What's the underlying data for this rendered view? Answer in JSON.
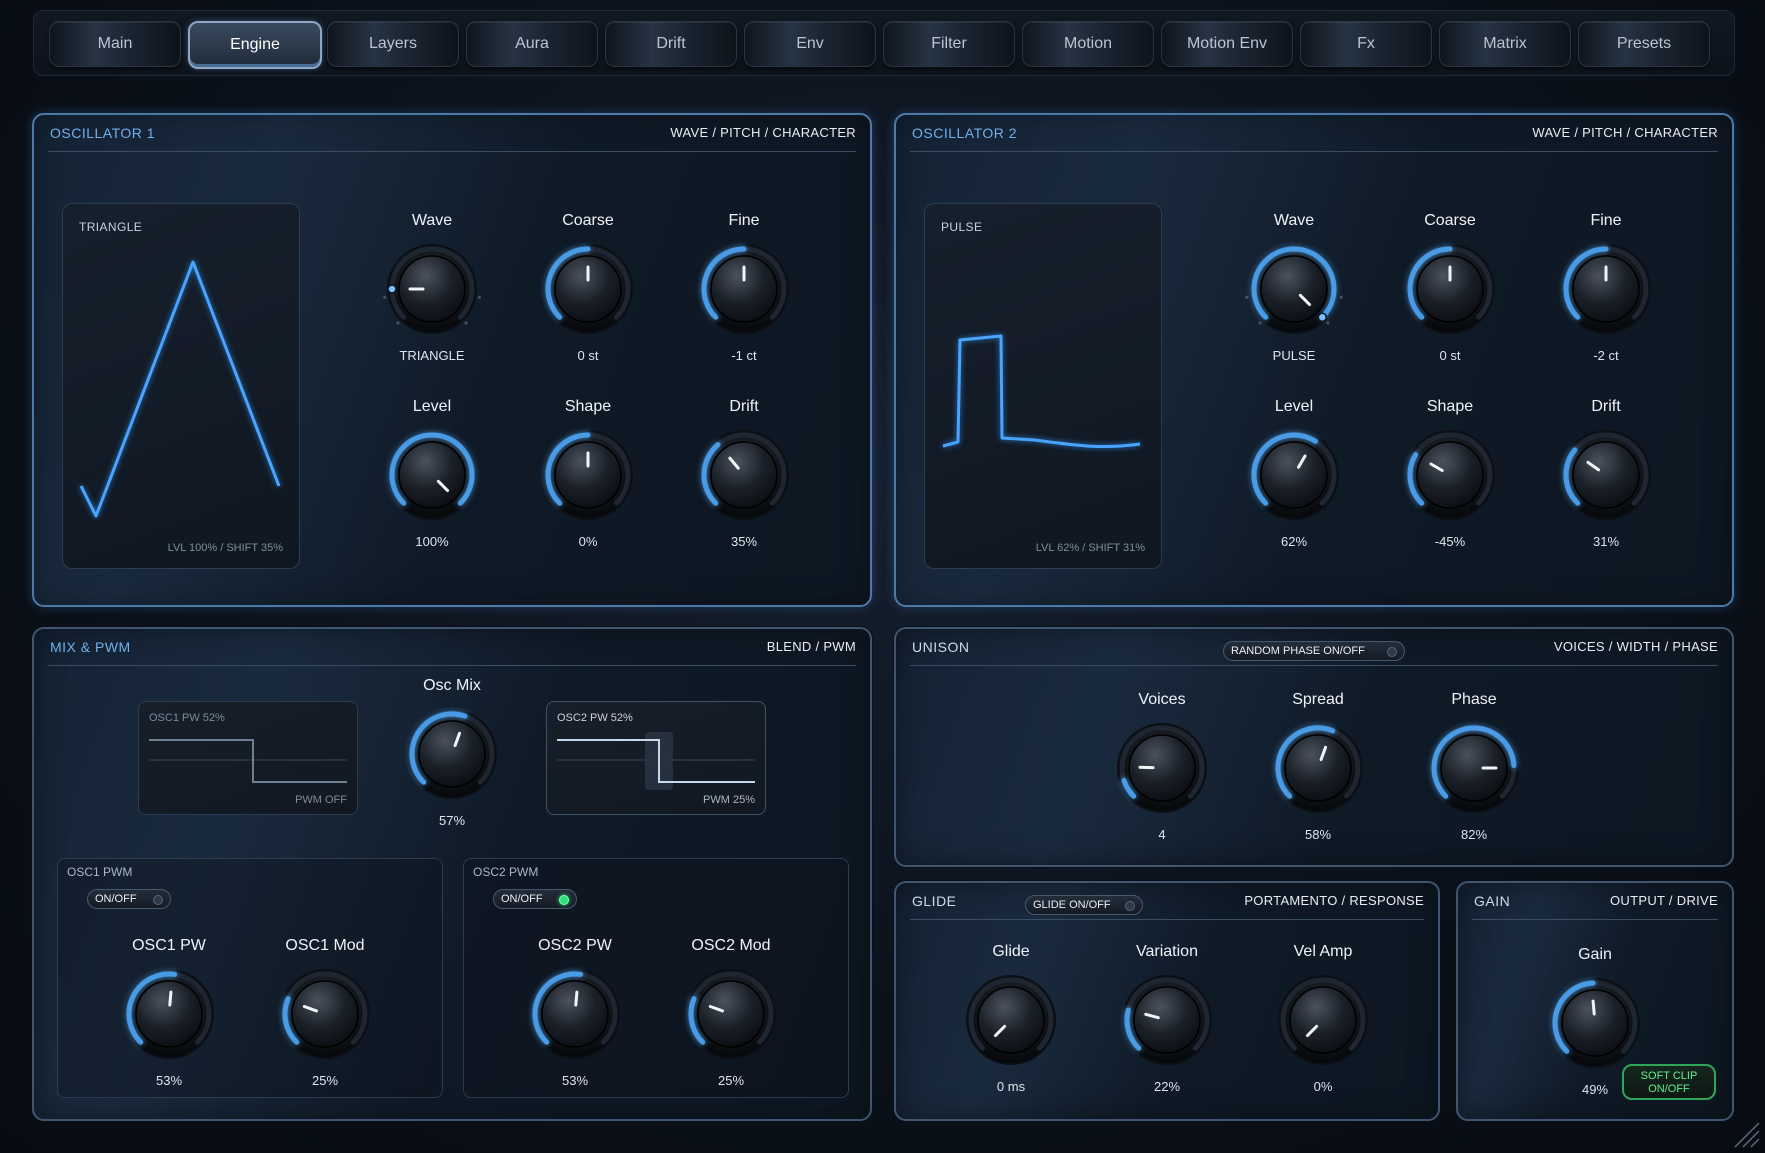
{
  "tabs": [
    {
      "label": "Main",
      "active": false
    },
    {
      "label": "Engine",
      "active": true
    },
    {
      "label": "Layers",
      "active": false
    },
    {
      "label": "Aura",
      "active": false
    },
    {
      "label": "Drift",
      "active": false
    },
    {
      "label": "Env",
      "active": false
    },
    {
      "label": "Filter",
      "active": false
    },
    {
      "label": "Motion",
      "active": false
    },
    {
      "label": "Motion Env",
      "active": false
    },
    {
      "label": "Fx",
      "active": false
    },
    {
      "label": "Matrix",
      "active": false
    },
    {
      "label": "Presets",
      "active": false
    }
  ],
  "osc1": {
    "title": "OSCILLATOR 1",
    "subtitle": "WAVE / PITCH / CHARACTER",
    "display": {
      "name": "TRIANGLE",
      "footer": "LVL 100% / SHIFT 35%"
    },
    "knobs": [
      {
        "label": "Wave",
        "value": "TRIANGLE"
      },
      {
        "label": "Coarse",
        "value": "0 st"
      },
      {
        "label": "Fine",
        "value": "-1 ct"
      },
      {
        "label": "Level",
        "value": "100%"
      },
      {
        "label": "Shape",
        "value": "0%"
      },
      {
        "label": "Drift",
        "value": "35%"
      }
    ]
  },
  "osc2": {
    "title": "OSCILLATOR 2",
    "subtitle": "WAVE / PITCH / CHARACTER",
    "display": {
      "name": "PULSE",
      "footer": "LVL 62% / SHIFT 31%"
    },
    "knobs": [
      {
        "label": "Wave",
        "value": "PULSE"
      },
      {
        "label": "Coarse",
        "value": "0 st"
      },
      {
        "label": "Fine",
        "value": "-2 ct"
      },
      {
        "label": "Level",
        "value": "62%"
      },
      {
        "label": "Shape",
        "value": "-45%"
      },
      {
        "label": "Drift",
        "value": "31%"
      }
    ]
  },
  "mix": {
    "title": "MIX & PWM",
    "subtitle": "BLEND / PWM",
    "osc1_pw_display": {
      "name": "OSC1 PW 52%",
      "footer": "PWM OFF"
    },
    "osc2_pw_display": {
      "name": "OSC2 PW 52%",
      "footer": "PWM 25%"
    },
    "osc_mix": {
      "label": "Osc Mix",
      "value": "57%"
    },
    "osc1_pwm": {
      "title": "OSC1 PWM",
      "toggle": "ON/OFF",
      "toggle_on": false,
      "knobs": [
        {
          "label": "OSC1 PW",
          "value": "53%"
        },
        {
          "label": "OSC1 Mod",
          "value": "25%"
        }
      ]
    },
    "osc2_pwm": {
      "title": "OSC2 PWM",
      "toggle": "ON/OFF",
      "toggle_on": true,
      "knobs": [
        {
          "label": "OSC2 PW",
          "value": "53%"
        },
        {
          "label": "OSC2 Mod",
          "value": "25%"
        }
      ]
    }
  },
  "unison": {
    "title": "UNISON",
    "subtitle": "VOICES / WIDTH / PHASE",
    "toggle": "RANDOM PHASE ON/OFF",
    "knobs": [
      {
        "label": "Voices",
        "value": "4"
      },
      {
        "label": "Spread",
        "value": "58%"
      },
      {
        "label": "Phase",
        "value": "82%"
      }
    ]
  },
  "glide": {
    "title": "GLIDE",
    "subtitle": "PORTAMENTO / RESPONSE",
    "toggle": "GLIDE ON/OFF",
    "knobs": [
      {
        "label": "Glide",
        "value": "0 ms"
      },
      {
        "label": "Variation",
        "value": "22%"
      },
      {
        "label": "Vel Amp",
        "value": "0%"
      }
    ]
  },
  "gain": {
    "title": "GAIN",
    "subtitle": "OUTPUT / DRIVE",
    "knob": {
      "label": "Gain",
      "value": "49%"
    },
    "softclip": "SOFT CLIP ON/OFF"
  },
  "colors": {
    "accent": "#4a9be6",
    "toggle_on": "#2ee07a",
    "softclip": "#5ff08f"
  }
}
